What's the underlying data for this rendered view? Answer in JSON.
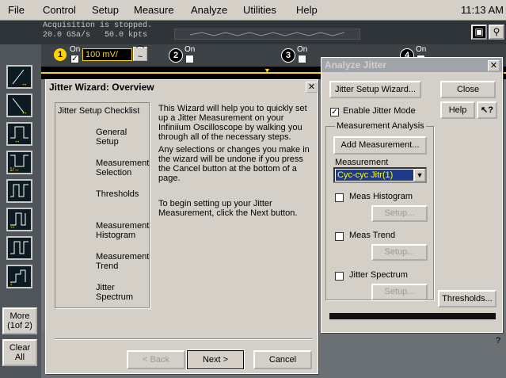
{
  "menubar": {
    "items": [
      "File",
      "Control",
      "Setup",
      "Measure",
      "Analyze",
      "Utilities",
      "Help"
    ],
    "time": "11:13 AM"
  },
  "status": {
    "acquisition": "Acquisition is stopped.",
    "rate": "20.0 GSa/s   50.0 kpts"
  },
  "channels": {
    "ch1": {
      "num": "1",
      "on_label": "On",
      "checked": "✓",
      "scale": "100 mV/"
    },
    "ch2": {
      "num": "2",
      "on_label": "On"
    },
    "ch3": {
      "num": "3",
      "on_label": "On"
    },
    "ch4": {
      "num": "4",
      "on_label": "On"
    }
  },
  "sidebar": {
    "more_label": "More\n(1of 2)",
    "more_line1": "More",
    "more_line2": "(1of 2)",
    "clear_line1": "Clear",
    "clear_line2": "All"
  },
  "wizard": {
    "title": "Jitter Wizard: Overview",
    "checklist_title": "Jitter Setup Checklist",
    "checklist": [
      [
        "General",
        "Setup"
      ],
      [
        "Measurement",
        "Selection"
      ],
      [
        "Thresholds",
        ""
      ],
      [
        "Measurement",
        "Histogram"
      ],
      [
        "Measurement",
        "Trend"
      ],
      [
        "Jitter",
        "Spectrum"
      ]
    ],
    "para1": "This Wizard will help you to quickly set up a Jitter Measurement on your Infiniium Oscilloscope by walking you through all of the necessary steps.",
    "para2": "Any selections or changes you make in the wizard will be undone if you press the Cancel button at the bottom of a page.",
    "para3": "To begin setting up your Jitter Measurement, click the Next button.",
    "back_label": "< Back",
    "next_label": "Next >",
    "cancel_label": "Cancel"
  },
  "analyze": {
    "title": "Analyze Jitter",
    "setup_wizard_label": "Jitter Setup Wizard...",
    "close_label": "Close",
    "enable_label": "Enable Jitter Mode",
    "enable_check": "✓",
    "help_label": "Help",
    "whatsthis_label": "?",
    "group_title": "Measurement Analysis",
    "add_measurement_label": "Add Measurement...",
    "measurement_label": "Measurement",
    "measurement_value": "Cyc-cyc Jitr(1)",
    "meas_histogram_label": "Meas Histogram",
    "meas_trend_label": "Meas Trend",
    "jitter_spectrum_label": "Jitter Spectrum",
    "setup_label": "Setup...",
    "thresholds_label": "Thresholds..."
  },
  "corner_help": "?"
}
